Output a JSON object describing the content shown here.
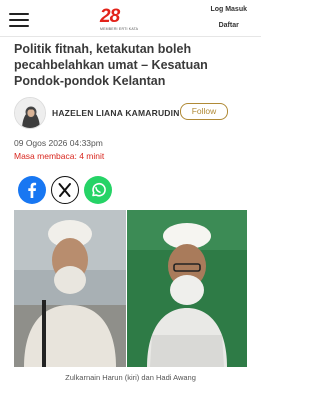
{
  "header": {
    "logo_text": "28",
    "logo_subtext": "MEMBERI ERTI KATA",
    "login_label": "Log Masuk",
    "register_label": "Daftar"
  },
  "article": {
    "title": "Politik fitnah, ketakutan boleh pecahbelahkan umat – Kesatuan Pondok-pondok Kelantan",
    "author": "HAZELEN LIANA KAMARUDIN",
    "follow_label": "Follow",
    "date": "09 Ogos 2026 04:33pm",
    "read_time": "Masa membaca: 4 minit",
    "caption": "Zulkarnain Harun (kiri) dan Hadi Awang"
  },
  "share": {
    "icons": [
      "facebook-icon",
      "x-icon",
      "whatsapp-icon"
    ]
  },
  "colors": {
    "brand_red": "#e2231a",
    "follow_gold": "#b08a36",
    "facebook_blue": "#1877f2",
    "whatsapp_green": "#25d366",
    "read_time_red": "#d9271f"
  }
}
